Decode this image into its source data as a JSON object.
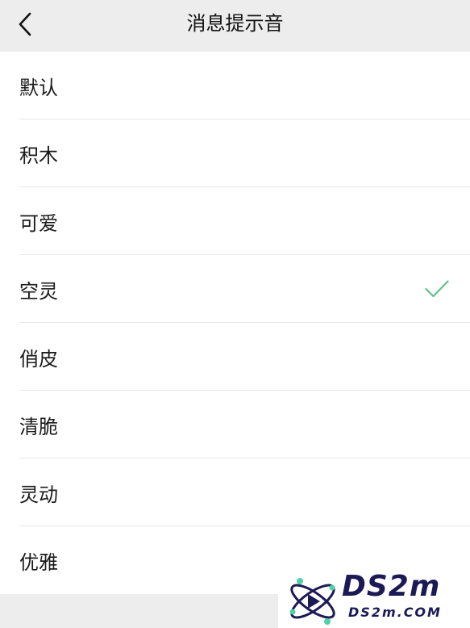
{
  "header": {
    "title": "消息提示音",
    "back_icon": "chevron-left-icon"
  },
  "sounds": [
    {
      "label": "默认",
      "selected": false
    },
    {
      "label": "积木",
      "selected": false
    },
    {
      "label": "可爱",
      "selected": false
    },
    {
      "label": "空灵",
      "selected": true
    },
    {
      "label": "俏皮",
      "selected": false
    },
    {
      "label": "清脆",
      "selected": false
    },
    {
      "label": "灵动",
      "selected": false
    },
    {
      "label": "优雅",
      "selected": false
    }
  ],
  "selected_icon": "checkmark-icon",
  "colors": {
    "background": "#ededed",
    "list_background": "#ffffff",
    "text": "#111111",
    "divider": "#e8e8e8",
    "check": "#62c084",
    "watermark": "#1c1a55",
    "watermark_dots": "#4fd1a5"
  },
  "watermark": {
    "brand": "DS2m",
    "site": "DS2m.COM"
  }
}
